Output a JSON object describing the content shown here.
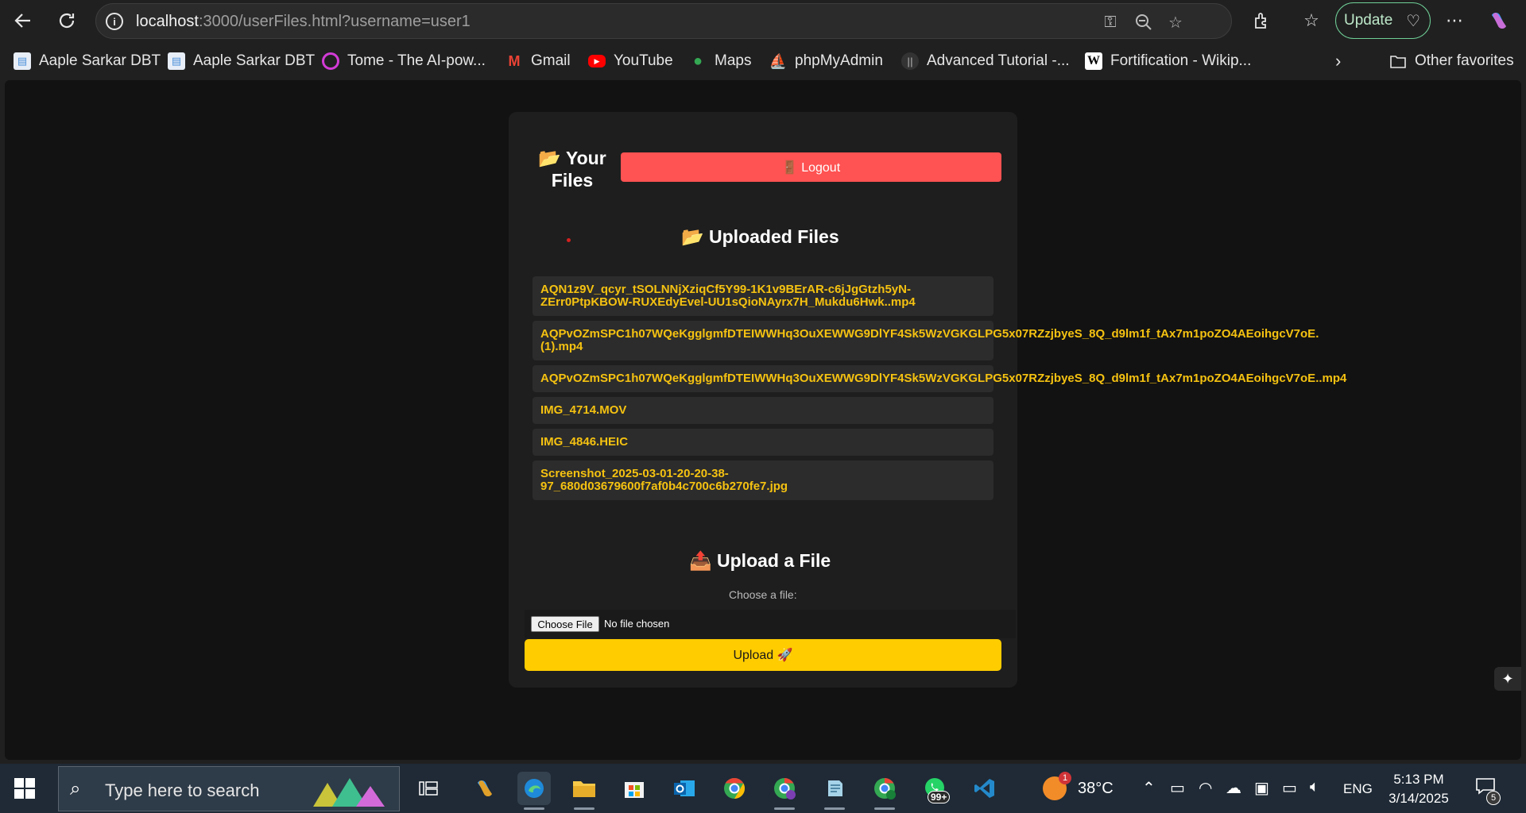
{
  "browser": {
    "url_host": "localhost",
    "url_rest": ":3000/userFiles.html?username=user1",
    "update_label": "Update",
    "other_favorites": "Other favorites"
  },
  "bookmarks": [
    {
      "label": "Aaple Sarkar DBT",
      "icon": "document-icon",
      "color": "#4a90d9"
    },
    {
      "label": "Aaple Sarkar DBT",
      "icon": "document-icon",
      "color": "#4a90d9"
    },
    {
      "label": "Tome - The AI-pow...",
      "icon": "tome-icon",
      "color": "#d23bd6"
    },
    {
      "label": "Gmail",
      "icon": "gmail-icon",
      "color": "#ea4335"
    },
    {
      "label": "YouTube",
      "icon": "youtube-icon",
      "color": "#ff0000"
    },
    {
      "label": "Maps",
      "icon": "maps-icon",
      "color": "#34a853"
    },
    {
      "label": "phpMyAdmin",
      "icon": "phpmyadmin-icon",
      "color": "#f29111"
    },
    {
      "label": "Advanced Tutorial -...",
      "icon": "tutorial-icon",
      "color": "#555555"
    },
    {
      "label": "Fortification - Wikip...",
      "icon": "wikipedia-icon",
      "color": "#ffffff"
    }
  ],
  "page": {
    "title_line1": "📂 Your",
    "title_line2": "Files",
    "logout_label": "🚪 Logout",
    "uploaded_title": "📂 Uploaded Files",
    "files": [
      {
        "lines": [
          "AQN1z9V_qcyr_tSOLNNjXziqCf5Y99-1K1v9BErAR-c6jJgGtzh5yN-",
          "ZErr0PtpKBOW-RUXEdyEvel-UU1sQioNAyrx7H_Mukdu6Hwk..mp4"
        ]
      },
      {
        "lines": [
          "AQPvOZmSPC1h07WQeKgglgmfDTEIWWHq3OuXEWWG9DlYF4Sk5WzVGKGLPG5x07RZzjbyeS_8Q_d9lm1f_tAx7m1poZO4AEoihgcV7oE.",
          "(1).mp4"
        ]
      },
      {
        "lines": [
          "AQPvOZmSPC1h07WQeKgglgmfDTEIWWHq3OuXEWWG9DlYF4Sk5WzVGKGLPG5x07RZzjbyeS_8Q_d9lm1f_tAx7m1poZO4AEoihgcV7oE..mp4"
        ]
      },
      {
        "lines": [
          "IMG_4714.MOV"
        ]
      },
      {
        "lines": [
          "IMG_4846.HEIC"
        ]
      },
      {
        "lines": [
          "Screenshot_2025-03-01-20-20-38-",
          "97_680d03679600f7af0b4c700c6b270fe7.jpg"
        ]
      }
    ],
    "upload_title": "📤 Upload a File",
    "choose_label": "Choose a file:",
    "choose_button": "Choose File",
    "no_file": "No file chosen",
    "upload_button": "Upload 🚀"
  },
  "taskbar": {
    "search_placeholder": "Type here to search",
    "weather_temp": "38°C",
    "weather_badge": "1",
    "language": "ENG",
    "time": "5:13 PM",
    "date": "3/14/2025",
    "notifications": "5",
    "whatsapp_badge": "99+"
  }
}
